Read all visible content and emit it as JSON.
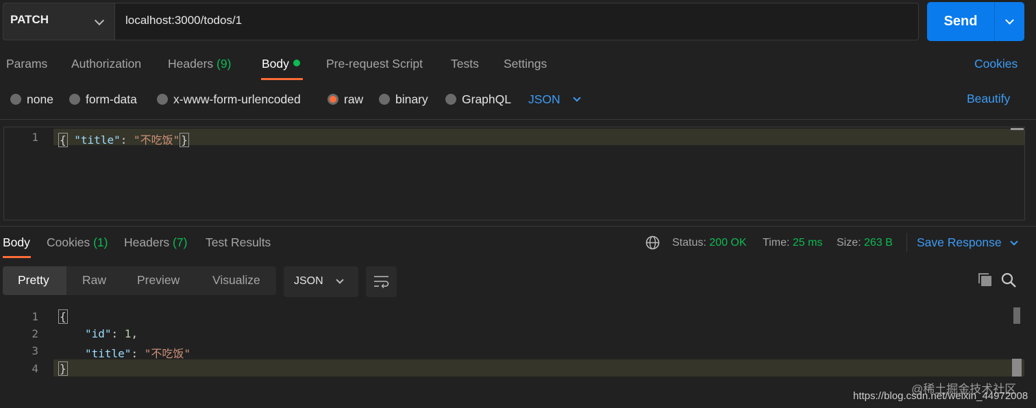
{
  "request": {
    "method": "PATCH",
    "url": "localhost:3000/todos/1",
    "send_label": "Send"
  },
  "request_tabs": {
    "params": "Params",
    "authorization": "Authorization",
    "headers": "Headers",
    "headers_count": "(9)",
    "body": "Body",
    "prerequest": "Pre-request Script",
    "tests": "Tests",
    "settings": "Settings",
    "cookies": "Cookies"
  },
  "body_types": {
    "none": "none",
    "form_data": "form-data",
    "urlencoded": "x-www-form-urlencoded",
    "raw": "raw",
    "binary": "binary",
    "graphql": "GraphQL",
    "format": "JSON",
    "beautify": "Beautify"
  },
  "request_editor": {
    "line1_no": "1",
    "open": "{",
    "key": "\"title\"",
    "colon": ": ",
    "value": "\"不吃饭\"",
    "close": "}"
  },
  "response_tabs": {
    "body": "Body",
    "cookies": "Cookies",
    "cookies_count": "(1)",
    "headers": "Headers",
    "headers_count": "(7)",
    "test_results": "Test Results"
  },
  "response_status": {
    "status_label": "Status:",
    "status_value": "200 OK",
    "time_label": "Time:",
    "time_value": "25 ms",
    "size_label": "Size:",
    "size_value": "263 B",
    "save_response": "Save Response"
  },
  "response_view": {
    "pretty": "Pretty",
    "raw": "Raw",
    "preview": "Preview",
    "visualize": "Visualize",
    "format": "JSON"
  },
  "response_editor": {
    "line_numbers": [
      "1",
      "2",
      "3",
      "4"
    ],
    "open": "{",
    "id_key": "\"id\"",
    "id_value": "1",
    "comma": ",",
    "title_key": "\"title\"",
    "title_value": "\"不吃饭\"",
    "close": "}"
  },
  "watermark": {
    "line1": "@稀土掘金技术社区",
    "line2": "https://blog.csdn.net/weixin_44972008"
  },
  "colors": {
    "accent_orange": "#ff6c37",
    "send_blue": "#097bed",
    "link_blue": "#3d9cf5",
    "status_green": "#0cbb52"
  }
}
